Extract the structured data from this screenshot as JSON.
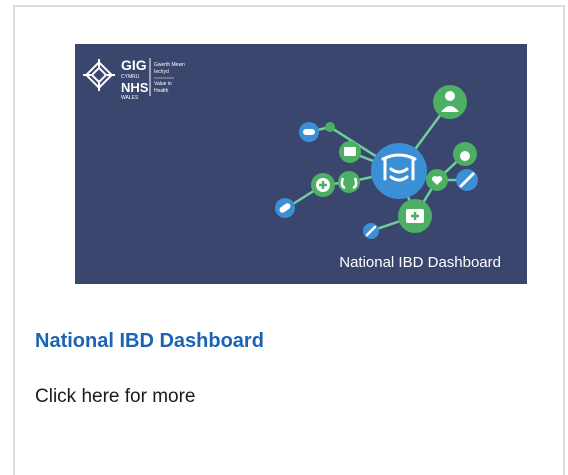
{
  "card": {
    "title": "National IBD Dashboard",
    "description": "Click here for more"
  },
  "banner": {
    "caption": "National IBD Dashboard",
    "logo": {
      "gig": "GIG",
      "cymru": "CYMRU",
      "nhs": "NHS",
      "wales": "WALES",
      "welsh_line1": "Gwerth Mewn",
      "welsh_line2": "Iechyd",
      "english_line1": "Value in",
      "english_line2": "Health"
    }
  },
  "colors": {
    "banner_background": "#3a466e",
    "title_link": "#1d63b5",
    "node_green": "#4caf63",
    "node_blue": "#3b8fd6",
    "network_line": "#6fcf9a"
  }
}
